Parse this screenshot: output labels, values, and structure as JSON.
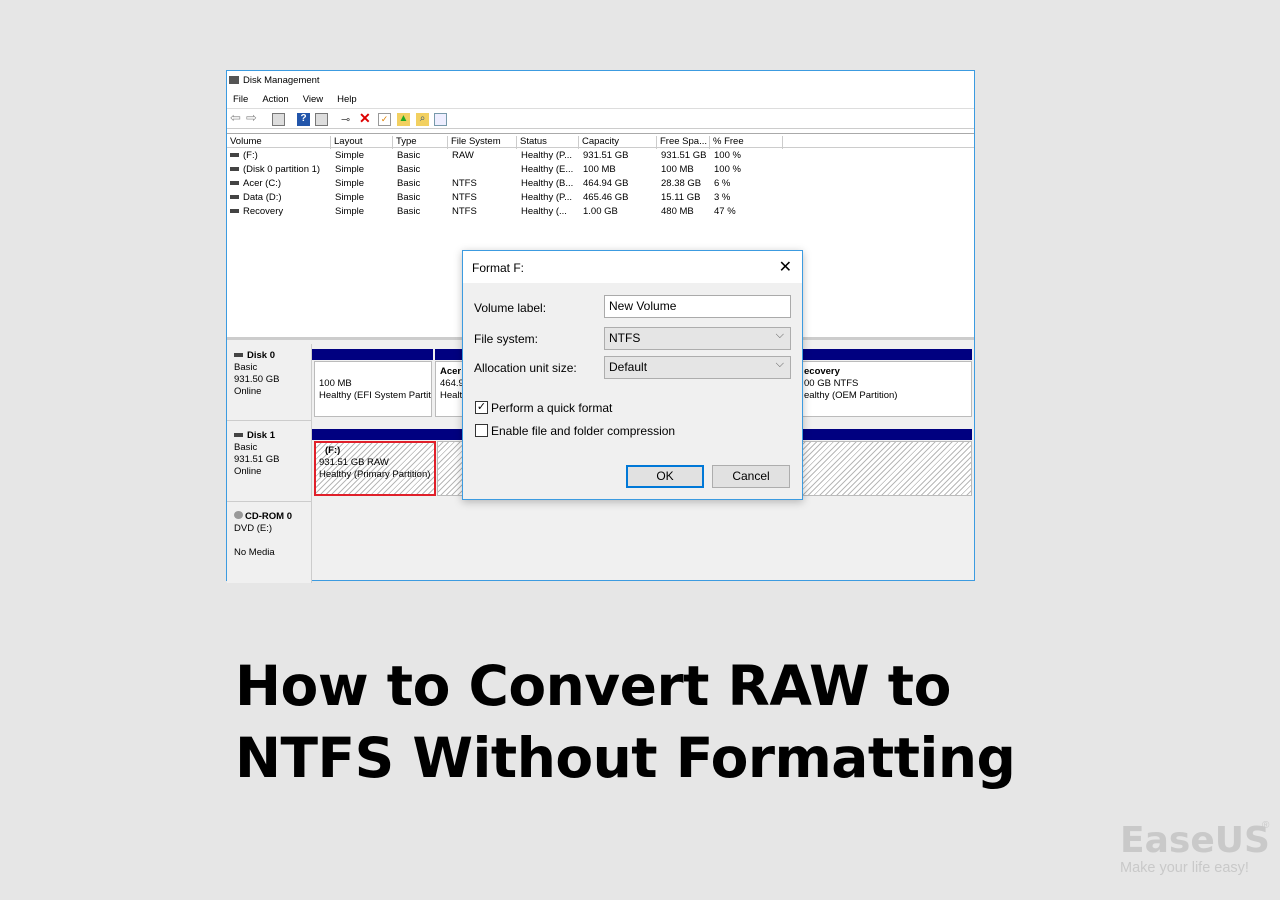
{
  "window": {
    "title": "Disk Management",
    "menu": [
      "File",
      "Action",
      "View",
      "Help"
    ]
  },
  "toolbar": [
    "back-icon",
    "forward-icon",
    "console-icon",
    "help-icon",
    "properties-icon",
    "connect-icon",
    "delete-icon",
    "check-icon",
    "up-icon",
    "find-icon",
    "list-icon"
  ],
  "volumes": {
    "columns": [
      "Volume",
      "Layout",
      "Type",
      "File System",
      "Status",
      "Capacity",
      "Free Spa...",
      "% Free"
    ],
    "rows": [
      [
        "(F:)",
        "Simple",
        "Basic",
        "RAW",
        "Healthy (P...",
        "931.51 GB",
        "931.51 GB",
        "100 %"
      ],
      [
        "(Disk 0 partition 1)",
        "Simple",
        "Basic",
        "",
        "Healthy (E...",
        "100 MB",
        "100 MB",
        "100 %"
      ],
      [
        "Acer (C:)",
        "Simple",
        "Basic",
        "NTFS",
        "Healthy (B...",
        "464.94 GB",
        "28.38 GB",
        "6 %"
      ],
      [
        "Data (D:)",
        "Simple",
        "Basic",
        "NTFS",
        "Healthy (P...",
        "465.46 GB",
        "15.11 GB",
        "3 %"
      ],
      [
        "Recovery",
        "Simple",
        "Basic",
        "NTFS",
        "Healthy (...",
        "1.00 GB",
        "480 MB",
        "47 %"
      ]
    ]
  },
  "disks": [
    {
      "name": "Disk 0",
      "type": "Basic",
      "size": "931.50 GB",
      "status": "Online",
      "partitions": [
        {
          "line1": "",
          "line2": "100 MB",
          "line3": "Healthy (EFI System Partiti"
        },
        {
          "line1": "Acer",
          "line2": "464.9",
          "line3": "Healt"
        },
        {
          "line1": "ecovery",
          "line2": "00 GB NTFS",
          "line3": "ealthy (OEM Partition)"
        }
      ]
    },
    {
      "name": "Disk 1",
      "type": "Basic",
      "size": "931.51 GB",
      "status": "Online",
      "partitions": [
        {
          "line1": "(F:)",
          "line2": "931.51 GB RAW",
          "line3": "Healthy (Primary Partition)"
        }
      ]
    },
    {
      "name": "CD-ROM 0",
      "type": "DVD (E:)",
      "status": "No Media"
    }
  ],
  "dialog": {
    "title": "Format F:",
    "volume_label_label": "Volume label:",
    "volume_label_value": "New Volume",
    "fs_label": "File system:",
    "fs_value": "NTFS",
    "alloc_label": "Allocation unit size:",
    "alloc_value": "Default",
    "quick_format": "Perform a quick format",
    "quick_format_checked": true,
    "compression": "Enable file and folder compression",
    "compression_checked": false,
    "ok": "OK",
    "cancel": "Cancel"
  },
  "headline": {
    "line1": "How to Convert RAW to",
    "line2": "NTFS Without Formatting"
  },
  "logo": {
    "brand": "EaseUS",
    "tagline": "Make your life easy!"
  },
  "colors": {
    "accent": "#3c9be0",
    "partition_bar": "#000080",
    "selected": "#e0202a"
  }
}
